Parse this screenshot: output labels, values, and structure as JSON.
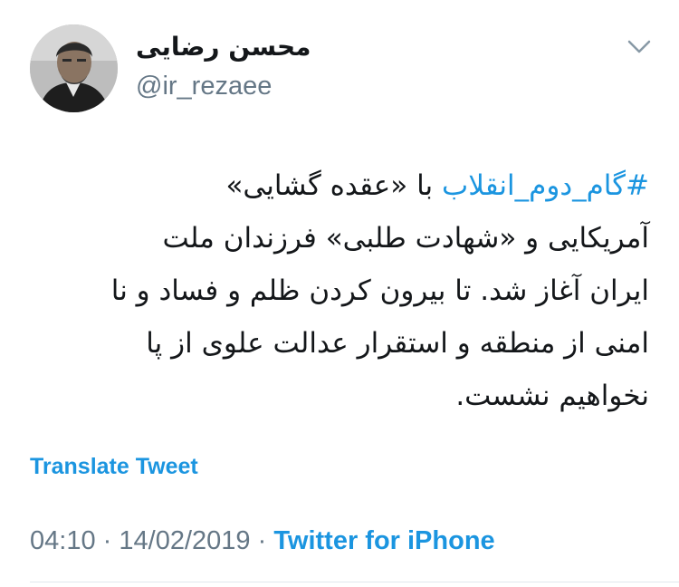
{
  "tweet": {
    "author": {
      "display_name": "محسن رضایی",
      "handle": "@ir_rezaee",
      "avatar_icon": "profile-photo"
    },
    "menu_icon": "chevron-down-icon",
    "hashtag": "#گام_دوم_انقلاب",
    "lines": {
      "line1_rest": " با «عقده گشایی»",
      "line2": "آمریکایی و «شهادت طلبی» فرزندان ملت",
      "line3": "ایران آغاز شد. تا بیرون کردن ظلم و فساد و نا",
      "line4": "امنی از منطقه و استقرار عدالت علوی از پا",
      "line5": "نخواهیم نشست."
    },
    "translate_label": "Translate Tweet",
    "time": "04:10",
    "separator": "·",
    "date": "14/02/2019",
    "source": "Twitter for iPhone"
  },
  "colors": {
    "link": "#1b95e0",
    "text": "#14171a",
    "muted": "#657786",
    "divider": "#e1e8ed"
  }
}
